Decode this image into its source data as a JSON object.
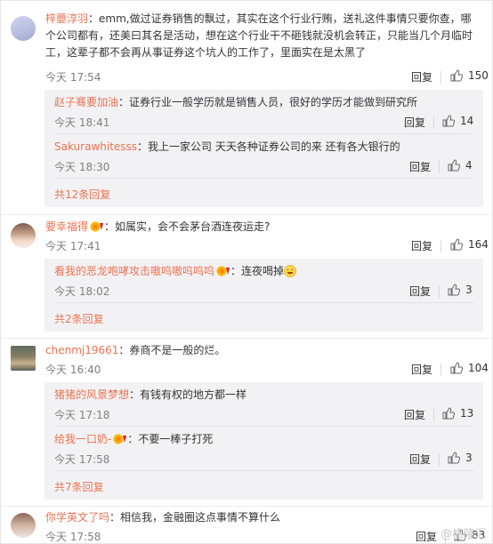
{
  "labels": {
    "reply": "回复"
  },
  "colors": {
    "username": "#eb7350",
    "meta": "#808080",
    "sub_bg": "#f2f2f5"
  },
  "comments": [
    {
      "username": "梓蘡淳羽",
      "text": "：emm,做过证券销售的飘过，其实在这个行业行贿，送礼这件事情只要你查，哪个公司都有，还美曰其名是活动，想在这个行业干不砸钱就没机会转正，只能当几个月临时工，这辈子都不会再从事证券这个坑人的工作了，里面实在是太黑了",
      "time": "今天 17:54",
      "likes": "150",
      "replies": [
        {
          "username": "赵子骞要加油",
          "text": "：证券行业一般学历就是销售人员，很好的学历才能做到研究所",
          "time": "今天 18:41",
          "likes": "14"
        },
        {
          "username": "Sakurawhitesss",
          "text": "：我上一家公司 天天各种证券公司的来 还有各大银行的",
          "time": "今天 18:30",
          "likes": "4"
        }
      ],
      "more": "共12条回复"
    },
    {
      "username": "要幸福得",
      "text": "：如属实，会不会茅台酒连夜运走?",
      "time": "今天 17:41",
      "likes": "164",
      "replies": [
        {
          "username": "看我的恶龙咆哮攻击嗷呜嗷呜呜呜",
          "text": "：连夜喝掉",
          "time": "今天 18:02",
          "likes": "3"
        }
      ],
      "more": "共2条回复"
    },
    {
      "username": "chenmj19661",
      "text": "：券商不是一般的烂。",
      "time": "今天 16:40",
      "likes": "104",
      "replies": [
        {
          "username": "猪猪的风景梦想",
          "text": "：有钱有权的地方都一样",
          "time": "今天 17:18",
          "likes": "13"
        },
        {
          "username": "给我一口奶-",
          "text": "：不要一棒子打死",
          "time": "今天 17:58",
          "likes": "3"
        }
      ],
      "more": "共7条回复"
    },
    {
      "username": "你学英文了吗",
      "text": "：相信我，金融圈这点事情不算什么",
      "time": "今天 17:58",
      "likes": "83"
    }
  ],
  "watermark": "@格隆汇"
}
